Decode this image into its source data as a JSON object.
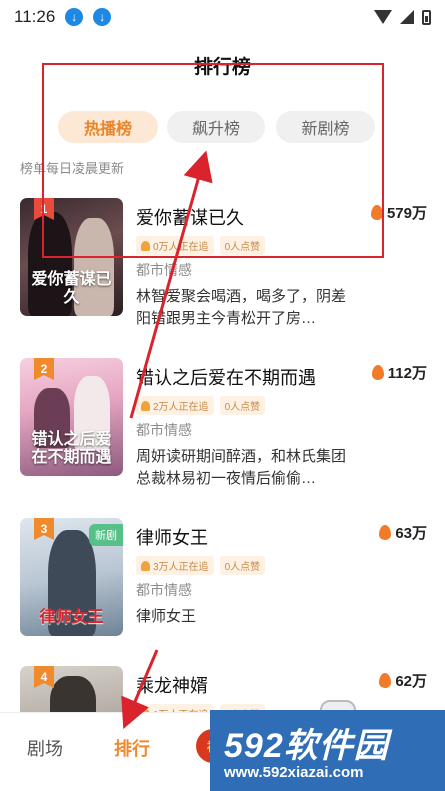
{
  "status_bar": {
    "time": "11:26",
    "icons": [
      "download-icon",
      "download-icon",
      "wifi-icon",
      "signal-icon",
      "battery-icon"
    ]
  },
  "header": {
    "title": "排行榜"
  },
  "tabs": [
    {
      "label": "热播榜",
      "active": true
    },
    {
      "label": "飙升榜",
      "active": false
    },
    {
      "label": "新剧榜",
      "active": false
    }
  ],
  "update_note": "榜单每日凌晨更新",
  "items": [
    {
      "rank": "1",
      "title": "爱你蓄谋已久",
      "heat": "579万",
      "watching": "0万人正在追",
      "likes": "0人点赞",
      "genre": "都市情感",
      "desc": "林智爱聚会喝酒，喝多了，阴差阳错跟男主今青松开了房…",
      "cover_text": "爱你蓄谋已久",
      "new_badge": ""
    },
    {
      "rank": "2",
      "title": "错认之后爱在不期而遇",
      "heat": "112万",
      "watching": "2万人正在追",
      "likes": "0人点赞",
      "genre": "都市情感",
      "desc": "周妍读研期间醉酒，和林氏集团总裁林易初一夜情后偷偷…",
      "cover_text": "错认之后爱在不期而遇",
      "new_badge": ""
    },
    {
      "rank": "3",
      "title": "律师女王",
      "heat": "63万",
      "watching": "3万人正在追",
      "likes": "0人点赞",
      "genre": "都市情感",
      "desc": "律师女王",
      "cover_text": "律师女王",
      "new_badge": "新剧"
    },
    {
      "rank": "4",
      "title": "乘龙神婿",
      "heat": "62万",
      "watching": "1万人正在追",
      "likes": "1人点赞",
      "genre": "",
      "desc": "",
      "cover_text": "",
      "new_badge": ""
    }
  ],
  "bottom_nav": {
    "theater": "剧场",
    "rank": "排行",
    "welfare": "福"
  },
  "watermark": {
    "main": "592软件园",
    "url": "www.592xiazai.com"
  },
  "colors": {
    "accent": "#ef8a2d",
    "annotation": "#d9232d",
    "watermark_bg": "#2f6db7"
  }
}
